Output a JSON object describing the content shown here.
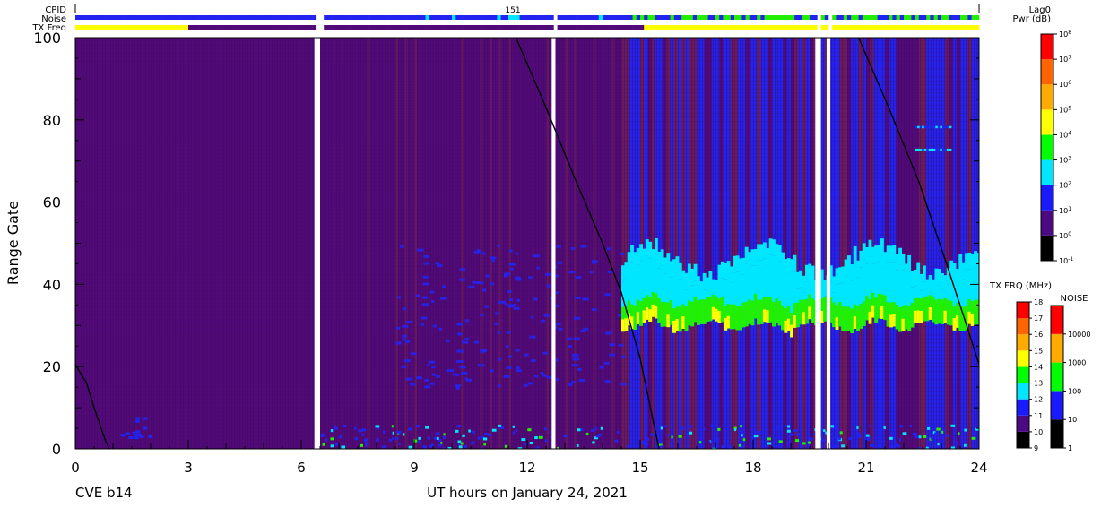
{
  "chart_data": {
    "type": "heatmap",
    "station": "CVE b14",
    "xlabel": "UT hours on January 24, 2021",
    "ylabel": "Range Gate",
    "xlim": [
      0,
      24
    ],
    "ylim": [
      0,
      100
    ],
    "x_ticks": [
      0,
      3,
      6,
      9,
      12,
      15,
      18,
      21,
      24
    ],
    "y_ticks": [
      0,
      20,
      40,
      60,
      80,
      100
    ],
    "strip_labels": {
      "cpid": "CPID",
      "noise": "Noise",
      "txfreq": "TX Freq"
    },
    "cpid_value": "151",
    "data_gaps_hours": [
      [
        6.35,
        6.5
      ],
      [
        12.65,
        12.75
      ],
      [
        19.65,
        19.8
      ],
      [
        19.95,
        20.05
      ]
    ],
    "curves": [
      {
        "name": "",
        "points": [
          [
            0,
            20.5
          ],
          [
            0.3,
            16
          ],
          [
            0.5,
            10
          ],
          [
            0.8,
            2
          ],
          [
            0.9,
            0
          ]
        ]
      },
      {
        "name": "",
        "points": [
          [
            11.7,
            100
          ],
          [
            12.5,
            83
          ],
          [
            13.3,
            65
          ],
          [
            14,
            50
          ],
          [
            14.5,
            38
          ],
          [
            15,
            22
          ],
          [
            15.5,
            0
          ]
        ]
      },
      {
        "name": "",
        "points": [
          [
            20.8,
            100
          ],
          [
            21.6,
            83
          ],
          [
            22.4,
            65
          ],
          [
            23.1,
            46
          ],
          [
            23.6,
            32
          ],
          [
            24,
            20.5
          ]
        ]
      }
    ],
    "echo_bands": [
      {
        "x_start": 14.5,
        "x_end": 24,
        "range_gate_min": 25,
        "range_gate_max": 45,
        "power_level": "10^2-10^4"
      }
    ],
    "power_scale": {
      "title": "Lag0",
      "subtitle": "Pwr (dB)",
      "labels": [
        "10^-1",
        "10^0",
        "10^1",
        "10^2",
        "10^3",
        "10^4",
        "10^5",
        "10^6",
        "10^7",
        "10^8"
      ],
      "colors": [
        "#000000",
        "#4b0a82",
        "#1a1aff",
        "#00e6ff",
        "#00ff00",
        "#ffff00",
        "#ffaa00",
        "#ff6400",
        "#ff0000"
      ]
    },
    "txfreq_scale": {
      "title": "TX FRQ (MHz)",
      "labels": [
        "9",
        "10",
        "11",
        "12",
        "13",
        "14",
        "15",
        "16",
        "17",
        "18"
      ],
      "colors": [
        "#000000",
        "#4b0a82",
        "#1a1aff",
        "#00e6ff",
        "#00ff00",
        "#ffff00",
        "#ffaa00",
        "#ff6400",
        "#ff0000"
      ]
    },
    "noise_scale": {
      "title": "NOISE",
      "labels": [
        "1",
        "10",
        "100",
        "1000",
        "10000"
      ],
      "colors": [
        "#000000",
        "#1a1aff",
        "#00ff00",
        "#ffaa00",
        "#ff0000"
      ]
    },
    "colors": {
      "background_purple": "#520a78",
      "maroon": "#6a1b5c",
      "blue": "#2323f0",
      "cyan": "#00e6ff",
      "green": "#22ee00",
      "yellow": "#ffff00",
      "curve": "#000000"
    }
  }
}
